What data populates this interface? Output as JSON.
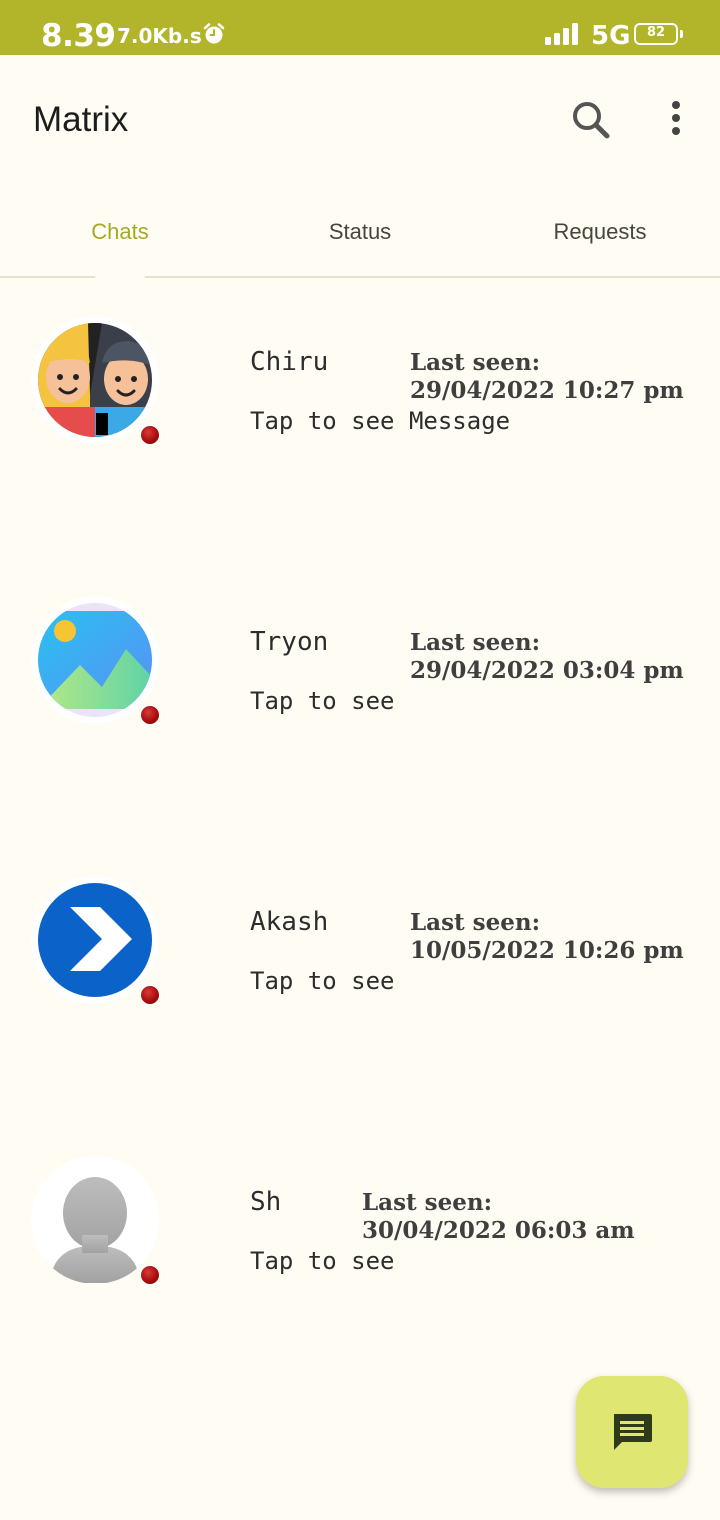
{
  "status_bar": {
    "time": "8.39",
    "speed": "7.0Kb.s",
    "network": "5G",
    "battery": "82",
    "icons": [
      "alarm-icon",
      "signal-icon",
      "battery-icon"
    ]
  },
  "app_bar": {
    "title": "Matrix",
    "icons": [
      "search-icon",
      "more-vert-icon"
    ]
  },
  "tabs": [
    {
      "label": "Chats",
      "active": true
    },
    {
      "label": "Status",
      "active": false
    },
    {
      "label": "Requests",
      "active": false
    }
  ],
  "chats": [
    {
      "name": "Chiru",
      "message": "Tap to see Message",
      "last_seen_label": "Last seen:",
      "last_seen_time": "29/04/2022 10:27 pm",
      "avatar": "two-people-avatar"
    },
    {
      "name": "Tryon",
      "message": "Tap to see",
      "last_seen_label": "Last seen:",
      "last_seen_time": "29/04/2022 03:04 pm",
      "avatar": "landscape-image-avatar"
    },
    {
      "name": "Akash",
      "message": "Tap to see",
      "last_seen_label": "Last seen:",
      "last_seen_time": "10/05/2022 10:26 pm",
      "avatar": "chevron-logo-avatar"
    },
    {
      "name": "Sh",
      "message": "Tap to see",
      "last_seen_label": "Last seen:",
      "last_seen_time": "30/04/2022 06:03 am",
      "avatar": "default-person-avatar"
    }
  ],
  "fab": {
    "icon": "new-message-icon"
  },
  "colors": {
    "status_bar": "#b2b52a",
    "background": "#fffcf3",
    "active_tab": "#a6a826",
    "fab": "#e0e672",
    "online_dot": "#a80d0d"
  }
}
